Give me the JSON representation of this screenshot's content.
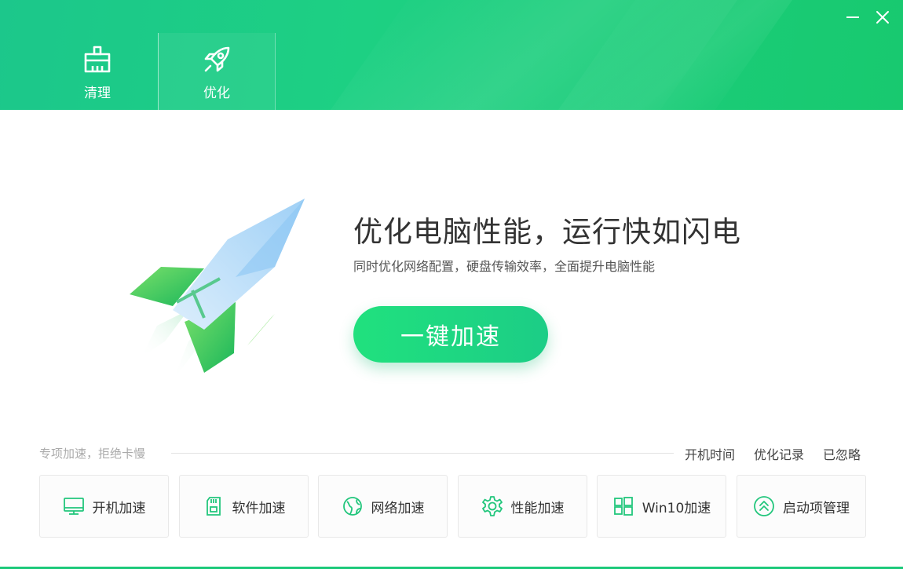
{
  "header": {
    "tabs": [
      {
        "label": "清理",
        "icon": "broom-icon"
      },
      {
        "label": "优化",
        "icon": "rocket-icon"
      }
    ],
    "active_tab": "优化"
  },
  "window_controls": {
    "minimize_icon": "minimize-icon",
    "close_icon": "close-icon"
  },
  "hero": {
    "title": "优化电脑性能，运行快如闪电",
    "subtitle": "同时优化网络配置，硬盘传输效率，全面提升电脑性能",
    "cta_label": "一键加速"
  },
  "section": {
    "title": "专项加速，拒绝卡慢",
    "links": [
      "开机时间",
      "优化记录",
      "已忽略"
    ],
    "cards": [
      {
        "label": "开机加速",
        "icon": "monitor-icon"
      },
      {
        "label": "软件加速",
        "icon": "sd-card-icon"
      },
      {
        "label": "网络加速",
        "icon": "globe-icon"
      },
      {
        "label": "性能加速",
        "icon": "gear-icon"
      },
      {
        "label": "Win10加速",
        "icon": "windows-icon"
      },
      {
        "label": "启动项管理",
        "icon": "chevrons-up-icon"
      }
    ]
  },
  "colors": {
    "accent": "#1dcf84",
    "accent_light": "#20e17e",
    "text_primary": "#333333",
    "text_muted": "#aaaaaa"
  }
}
